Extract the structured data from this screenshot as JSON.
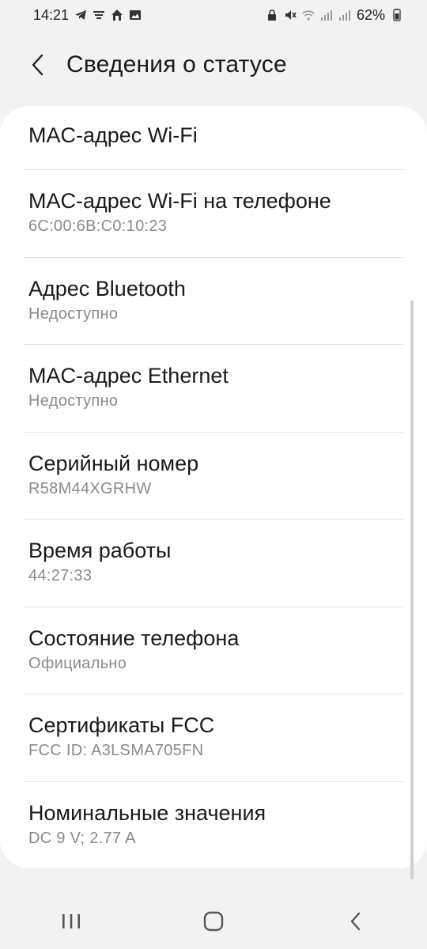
{
  "status_bar": {
    "time": "14:21",
    "battery_percent": "62%",
    "left_icons": [
      "telegram-icon",
      "cast-icon",
      "home-alert-icon",
      "image-icon"
    ],
    "right_icons": [
      "lock-icon",
      "mute-icon",
      "wifi-icon",
      "signal-icon",
      "signal-icon-2",
      "battery-icon"
    ]
  },
  "header": {
    "title": "Сведения о статусе",
    "back_icon": "chevron-left-icon"
  },
  "items": [
    {
      "title": "MAC-адрес Wi-Fi",
      "subtitle": ""
    },
    {
      "title": "MAC-адрес Wi-Fi на телефоне",
      "subtitle": "6C:00:6B:C0:10:23"
    },
    {
      "title": "Адрес Bluetooth",
      "subtitle": "Недоступно"
    },
    {
      "title": "MAC-адрес Ethernet",
      "subtitle": "Недоступно"
    },
    {
      "title": "Серийный номер",
      "subtitle": "R58M44XGRHW"
    },
    {
      "title": "Время работы",
      "subtitle": "44:27:33"
    },
    {
      "title": "Состояние телефона",
      "subtitle": "Официально"
    },
    {
      "title": "Сертификаты FCC",
      "subtitle": "FCC ID: A3LSMA705FN"
    },
    {
      "title": "Номинальные значения",
      "subtitle": "DC 9 V; 2.77 A"
    }
  ],
  "nav_bar": {
    "icons": [
      "recent-apps-icon",
      "home-icon",
      "back-icon"
    ]
  },
  "colors": {
    "background": "#f2f2f2",
    "card": "#ffffff",
    "text": "#1a1a1a",
    "subtext": "#8a8a8a"
  }
}
